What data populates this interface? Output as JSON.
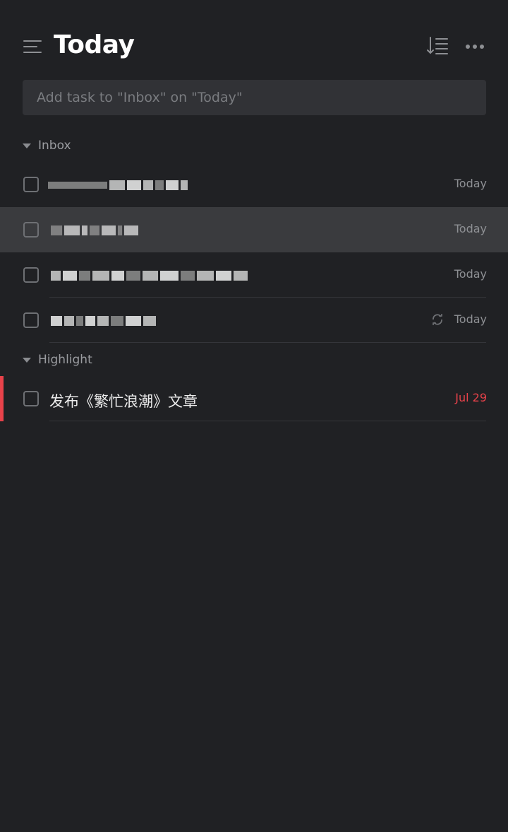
{
  "header": {
    "title": "Today"
  },
  "add_task": {
    "placeholder": "Add task to \"Inbox\" on \"Today\""
  },
  "sections": [
    {
      "label": "Inbox",
      "tasks": [
        {
          "date": "Today",
          "blurred": true
        },
        {
          "date": "Today",
          "blurred": true
        },
        {
          "date": "Today",
          "blurred": true
        },
        {
          "date": "Today",
          "blurred": true,
          "repeat": true
        }
      ]
    },
    {
      "label": "Highlight",
      "tasks": [
        {
          "title": "发布《繁忙浪潮》文章",
          "date": "Jul 29",
          "overdue": true
        }
      ]
    }
  ],
  "colors": {
    "background": "#202124",
    "accent_red": "#e8424a",
    "hover_row": "#3a3b3e"
  },
  "icons": [
    "menu-icon",
    "sort-icon",
    "more-icon",
    "caret-down-icon",
    "checkbox-icon",
    "repeat-icon"
  ]
}
